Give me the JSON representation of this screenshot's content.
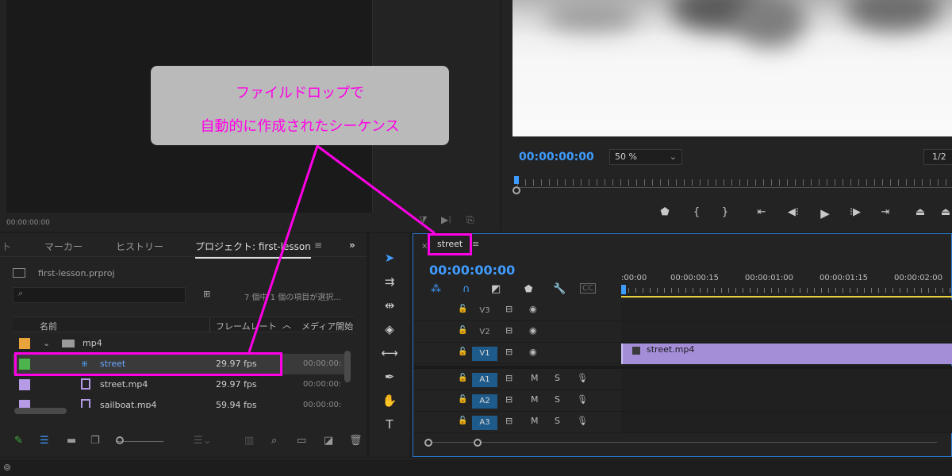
{
  "source_monitor": {
    "timecode": "00:00:00:00"
  },
  "program_monitor": {
    "timecode": "00:00:00:00",
    "zoom": "50 %",
    "resolution": "1/2",
    "transport_icons": [
      "add-marker-icon",
      "mark-in-icon",
      "mark-out-icon",
      "go-to-in-icon",
      "step-back-icon",
      "play-icon",
      "step-forward-icon",
      "go-to-out-icon",
      "lift-icon",
      "extract-icon"
    ]
  },
  "project_panel": {
    "tabs": [
      "マーカー",
      "ヒストリー",
      "プロジェクト: first-lesson"
    ],
    "file": "first-lesson.prproj",
    "search_placeholder": "",
    "item_count": "7 個中 1 個の項目が選択...",
    "columns": {
      "name": "名前",
      "frame_rate": "フレームレート",
      "media_start": "メディア開始"
    },
    "folder": "mp4",
    "rows": [
      {
        "name": "street",
        "fps": "29.97 fps",
        "start": "00:00:00:",
        "color": "#4db34d",
        "selected": true
      },
      {
        "name": "street.mp4",
        "fps": "29.97 fps",
        "start": "00:00:00:",
        "color": "#b59be6",
        "selected": false
      },
      {
        "name": "sailboat.mp4",
        "fps": "59.94 fps",
        "start": "00:00:00:",
        "color": "#b59be6",
        "selected": false
      }
    ],
    "folder_color": "#e8a33a"
  },
  "timeline": {
    "sequence_name": "street",
    "timecode": "00:00:00:00",
    "ruler_labels": [
      ":00:00",
      "00:00:00:15",
      "00:00:01:00",
      "00:00:01:15",
      "00:00:02:00"
    ],
    "video_tracks": [
      "V3",
      "V2",
      "V1"
    ],
    "audio_tracks": [
      "A1",
      "A2",
      "A3"
    ],
    "audio_buttons": {
      "mute": "M",
      "solo": "S"
    },
    "clip_name": "street.mp4"
  },
  "callout": {
    "line1": "ファイルドロップで",
    "line2": "自動的に作成されたシーケンス"
  },
  "colors": {
    "accent": "#3f9cff",
    "highlight": "#ff00e6",
    "clip": "#a48ed8"
  }
}
